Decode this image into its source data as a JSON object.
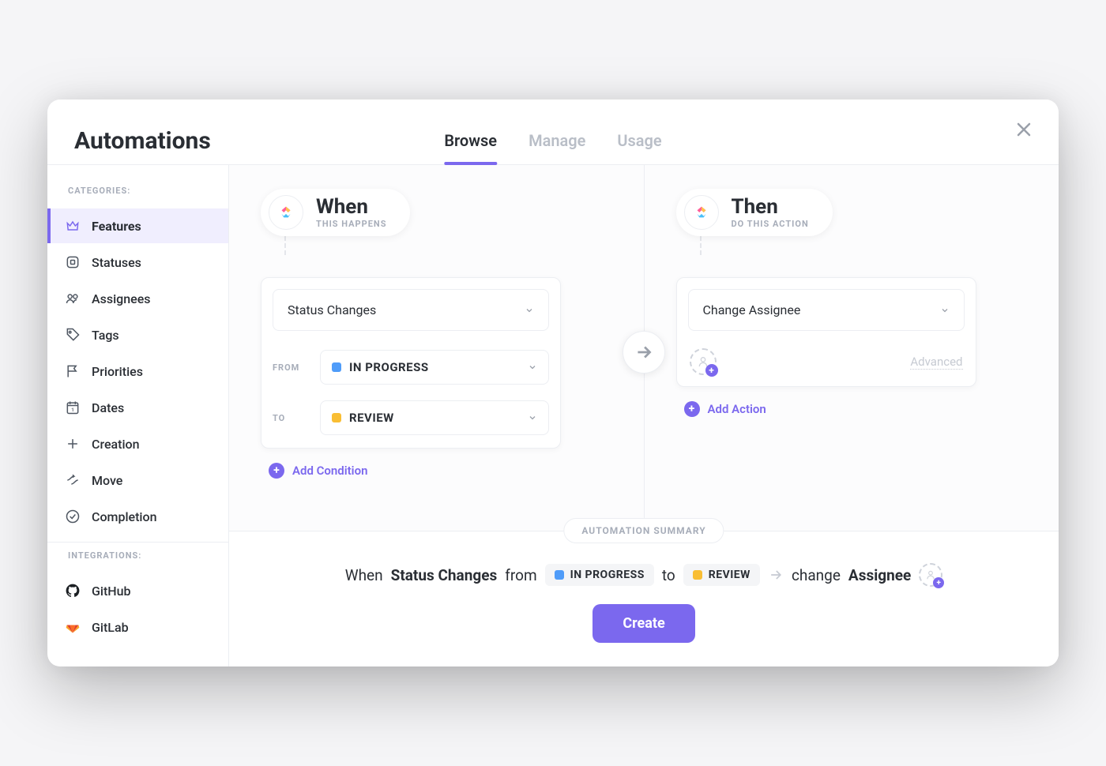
{
  "header": {
    "title": "Automations",
    "tabs": [
      {
        "label": "Browse",
        "active": true
      },
      {
        "label": "Manage",
        "active": false
      },
      {
        "label": "Usage",
        "active": false
      }
    ]
  },
  "sidebar": {
    "categories_label": "CATEGORIES:",
    "integrations_label": "INTEGRATIONS:",
    "categories": [
      {
        "label": "Features",
        "icon": "crown",
        "active": true
      },
      {
        "label": "Statuses",
        "icon": "square",
        "active": false
      },
      {
        "label": "Assignees",
        "icon": "people",
        "active": false
      },
      {
        "label": "Tags",
        "icon": "tag",
        "active": false
      },
      {
        "label": "Priorities",
        "icon": "flag",
        "active": false
      },
      {
        "label": "Dates",
        "icon": "calendar",
        "active": false
      },
      {
        "label": "Creation",
        "icon": "plus",
        "active": false
      },
      {
        "label": "Move",
        "icon": "arrow",
        "active": false
      },
      {
        "label": "Completion",
        "icon": "check",
        "active": false
      }
    ],
    "integrations": [
      {
        "label": "GitHub",
        "icon": "github"
      },
      {
        "label": "GitLab",
        "icon": "gitlab"
      }
    ]
  },
  "when": {
    "title": "When",
    "subtitle": "THIS HAPPENS",
    "trigger_label": "Status Changes",
    "from_label": "FROM",
    "to_label": "TO",
    "from_status": {
      "name": "IN PROGRESS",
      "color": "#4f9cf9"
    },
    "to_status": {
      "name": "REVIEW",
      "color": "#f9be34"
    },
    "add_condition": "Add Condition"
  },
  "then": {
    "title": "Then",
    "subtitle": "DO THIS ACTION",
    "action_label": "Change Assignee",
    "advanced_label": "Advanced",
    "add_action": "Add Action"
  },
  "summary": {
    "badge": "AUTOMATION SUMMARY",
    "when_word": "When",
    "trigger": "Status Changes",
    "from_word": "from",
    "to_word": "to",
    "from_status": {
      "name": "IN PROGRESS",
      "color": "#4f9cf9"
    },
    "to_status": {
      "name": "REVIEW",
      "color": "#f9be34"
    },
    "change_word": "change",
    "assignee_word": "Assignee",
    "create_button": "Create"
  },
  "colors": {
    "accent": "#7b68ee"
  }
}
